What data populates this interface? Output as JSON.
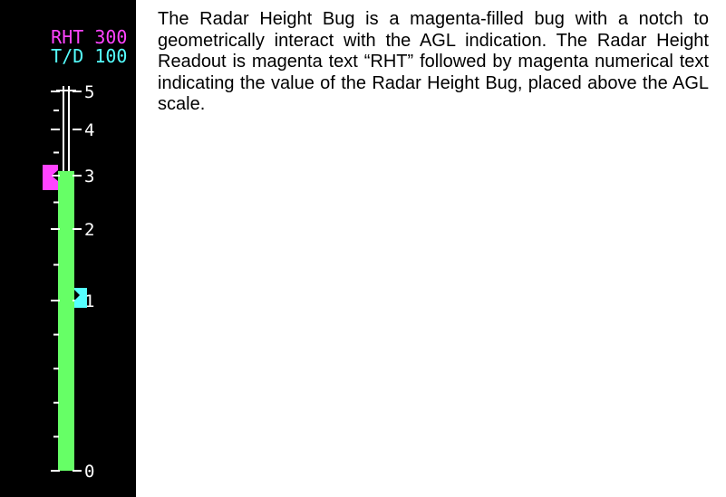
{
  "readouts": {
    "radar_height": {
      "label": "RHT",
      "value": "300",
      "color": "#ff44ff"
    },
    "touchdown": {
      "label": "T/D",
      "value": "100",
      "color": "#55ffff"
    }
  },
  "scale": {
    "labels": [
      "5",
      "4",
      "3",
      "2",
      "1",
      "0"
    ],
    "text_color": "#ffffff",
    "agl_fill_color": "#66ff66",
    "agl_top_value": 3.1,
    "radar_height_bug_value": 3.0,
    "radar_height_bug_color": "#ff44ff",
    "touchdown_bug_value": 1.0,
    "touchdown_bug_color": "#55ffff"
  },
  "description": "The Radar Height Bug is a magenta-filled bug with a notch to geometrically interact with the AGL indication. The Radar Height Readout is magenta text “RHT” followed by magenta numerical text indicating the value of the Radar Height Bug, placed above the AGL scale."
}
